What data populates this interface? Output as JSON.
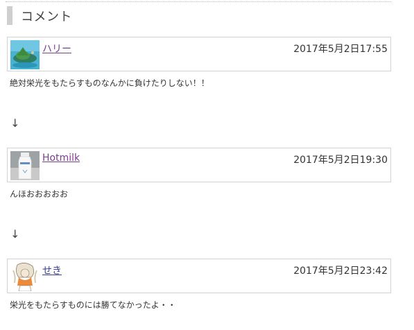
{
  "section": {
    "title": "コメント"
  },
  "comments": [
    {
      "author": "ハリー",
      "date": "2017年5月2日17:55",
      "body": "絶対栄光をもたらすものなんかに負けたりしない！！",
      "avatar_icon": "island-avatar-icon"
    },
    {
      "author": "Hotmilk",
      "date": "2017年5月2日19:30",
      "body": "んほおおおおお",
      "avatar_icon": "milk-bottle-avatar-icon"
    },
    {
      "author": "せき",
      "date": "2017年5月2日23:42",
      "body": "栄光をもたらすものには勝てなかったよ・・",
      "avatar_icon": "anime-character-avatar-icon"
    }
  ],
  "separators": {
    "arrow": "↓"
  },
  "colors": {
    "author_link": "#7a3e8e",
    "author_link_alt": "#3a3f8f",
    "border": "#d2d2d2",
    "section_bar": "#cfcfcf"
  }
}
